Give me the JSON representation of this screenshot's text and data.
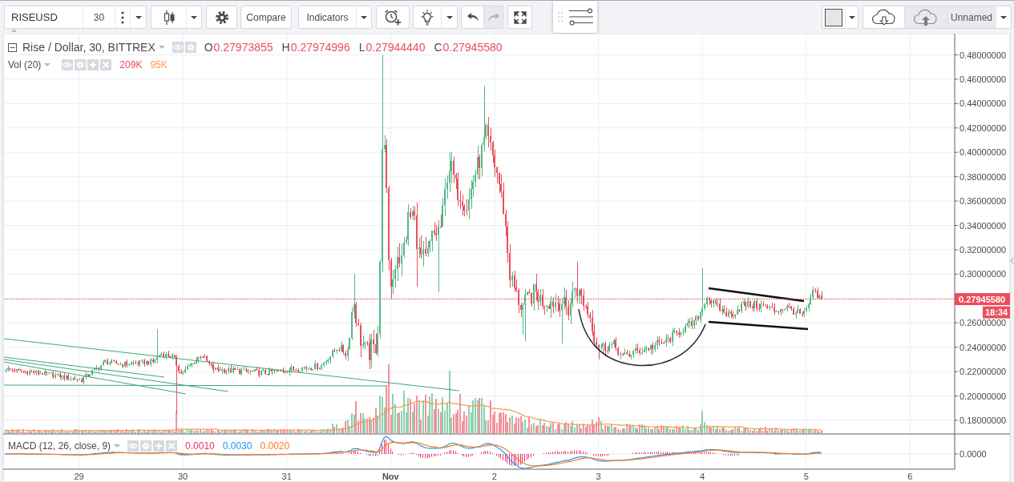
{
  "toolbar": {
    "symbol": {
      "value": "RISEUSD"
    },
    "interval": "30",
    "compare_button": "Compare",
    "indicators_button": "Indicators",
    "history": [
      {
        "kind": "undo",
        "disabled": false
      },
      {
        "kind": "redo",
        "disabled": true
      }
    ]
  },
  "layout_menu": {
    "buttons": [
      {
        "kind": "load",
        "disabled": false
      },
      {
        "kind": "save",
        "disabled": true
      }
    ],
    "name": "Unnamed"
  },
  "chart": {
    "legend": {
      "title": "Rise / Dollar, 30, BITTREX",
      "ohlc": [
        {
          "label": "O",
          "value": "0.27973855"
        },
        {
          "label": "H",
          "value": "0.27974996"
        },
        {
          "label": "L",
          "value": "0.27944440"
        },
        {
          "label": "C",
          "value": "0.27945580"
        }
      ]
    },
    "volume_legend": {
      "title": "Vol (20)",
      "values": [
        {
          "text": "209K",
          "color": "#eb4d5c"
        },
        {
          "text": "95K",
          "color": "#ff9850"
        }
      ]
    },
    "price_axis": {
      "labels": [
        "0.48000000",
        "0.46000000",
        "0.44000000",
        "0.42000000",
        "0.40000000",
        "0.38000000",
        "0.36000000",
        "0.34000000",
        "0.32000000",
        "0.30000000",
        "0.26000000",
        "0.24000000",
        "0.22000000",
        "0.20000000",
        "0.18000000"
      ],
      "last_price": "0.27945580",
      "countdown": "18:34"
    },
    "macd_legend": {
      "title": "MACD (12, 26, close, 9)",
      "values": [
        {
          "text": "0.0010",
          "color": "#f0306a"
        },
        {
          "text": "0.0030",
          "color": "#2196f3"
        },
        {
          "text": "0.0020",
          "color": "#ff7a1a"
        }
      ]
    },
    "macd_axis": {
      "labels": [
        "0.0000"
      ]
    },
    "time_axis": {
      "labels": [
        {
          "text": "29",
          "kind": "day"
        },
        {
          "text": "30",
          "kind": "day"
        },
        {
          "text": "31",
          "kind": "day"
        },
        {
          "text": "Nov",
          "kind": "month"
        },
        {
          "text": "2",
          "kind": "day"
        },
        {
          "text": "3",
          "kind": "day"
        },
        {
          "text": "4",
          "kind": "day"
        },
        {
          "text": "5",
          "kind": "day"
        },
        {
          "text": "6",
          "kind": "day"
        }
      ]
    }
  }
}
